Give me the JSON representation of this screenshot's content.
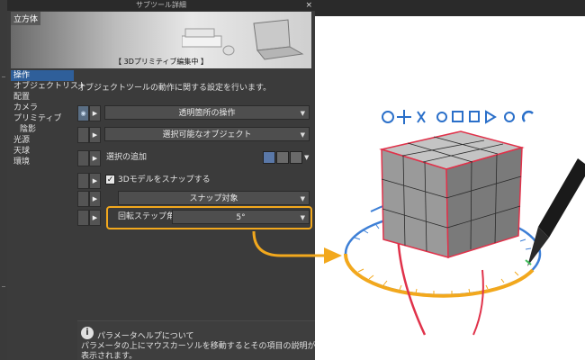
{
  "window": {
    "title": "サブツール詳細",
    "close": "×"
  },
  "preview": {
    "category": "立方体",
    "caption": "【 3Dプリミティブ編集中 】"
  },
  "nav": {
    "items": [
      {
        "label": "操作",
        "active": true,
        "sub": false
      },
      {
        "label": "オブジェクトリスト",
        "active": false,
        "sub": false
      },
      {
        "label": "配置",
        "active": false,
        "sub": false
      },
      {
        "label": "カメラ",
        "active": false,
        "sub": false
      },
      {
        "label": "プリミティブ",
        "active": false,
        "sub": false
      },
      {
        "label": "陰影",
        "active": false,
        "sub": true
      },
      {
        "label": "光源",
        "active": false,
        "sub": false
      },
      {
        "label": "天球",
        "active": false,
        "sub": false
      },
      {
        "label": "環境",
        "active": false,
        "sub": false
      }
    ]
  },
  "settings": {
    "description": "オブジェクトツールの動作に関する設定を行います。",
    "transparent_op": "透明箇所の操作",
    "selectable_obj": "選択可能なオブジェクト",
    "add_selection": "選択の追加",
    "snap_3d": "3Dモデルをスナップする",
    "snap_target": "スナップ対象",
    "rotate_step_label": "回転ステップ角",
    "rotate_step_value": "5°"
  },
  "help": {
    "icon": "i",
    "title": "パラメータヘルプについて",
    "text": "パラメータの上にマウスカーソルを移動するとその項目の説明が表示されます。"
  },
  "colors": {
    "accent_orange": "#f2a81d",
    "ring_blue": "#3d7fd6",
    "axis_red": "#e0324a",
    "selection_blue": "#2f5f9a"
  }
}
